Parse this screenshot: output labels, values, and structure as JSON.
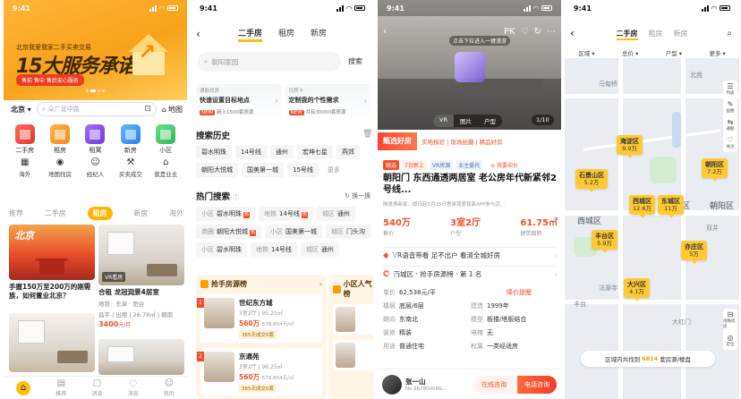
{
  "screen1": {
    "status_time": "9:41",
    "banner": {
      "subtitle": "北京我爱我家二手买卖交易",
      "headline": "15大服务承诺",
      "tag": "售前 售中 售后安心服务"
    },
    "city": "北京",
    "search_placeholder": "朵广营中路",
    "map_label": "地图",
    "main_icons": [
      {
        "label": "二手房"
      },
      {
        "label": "租房"
      },
      {
        "label": "租寓"
      },
      {
        "label": "新房"
      },
      {
        "label": "小区"
      }
    ],
    "sub_icons": [
      {
        "label": "海外",
        "icon": "building-icon"
      },
      {
        "label": "地图找房",
        "icon": "map-pin-icon"
      },
      {
        "label": "经纪人",
        "icon": "agent-icon"
      },
      {
        "label": "买卖成交",
        "icon": "hammer-icon"
      },
      {
        "label": "我是业主",
        "icon": "owner-icon"
      }
    ],
    "tabs": [
      "推荐",
      "二手房",
      "租房",
      "新房",
      "海外"
    ],
    "active_tab": "租房",
    "cards": [
      {
        "title": "手握150万至200万的刚需族，如何置业北京？",
        "image_text": "北京"
      },
      {
        "title": "合租 龙冠润景4居室",
        "meta1": "地铁 · 东单 · 阳台",
        "meta2": "昌平 | 出租 | 26.78㎡ | 朝南",
        "price": "3400",
        "unit": "元/月",
        "vr": "VR看房"
      },
      {
        "title": "",
        "image_text": ""
      },
      {
        "title": "",
        "image_text": ""
      }
    ],
    "nav": [
      "首页",
      "推荐",
      "消息",
      "消息",
      "我的"
    ]
  },
  "screen2": {
    "status_time": "9:41",
    "tabs": [
      "二手房",
      "租房",
      "新房"
    ],
    "active_tab": "二手房",
    "search_placeholder": "朝阳家园",
    "search_btn": "搜索",
    "promos": [
      {
        "top": "通勤找房",
        "title": "快速设置目标地点",
        "badge": "NEW",
        "note": "新上1500套房源"
      },
      {
        "top": "优质卡",
        "title": "定制我的个性需求",
        "badge": "NEW",
        "note": "共有30000套房源"
      }
    ],
    "history_title": "搜索历史",
    "history": [
      "碧水明珠",
      "14号线",
      "通州",
      "宏坤七星",
      "燕郊",
      "朝阳大悦城",
      "国美第一城",
      "15号线",
      "更多"
    ],
    "hot_title": "热门搜索",
    "refresh": "换一换",
    "hot": [
      {
        "k": "小区",
        "v": "碧水明珠",
        "hot": true
      },
      {
        "k": "地铁",
        "v": "14号线",
        "hot": true
      },
      {
        "k": "城区",
        "v": "通州",
        "hot": false
      },
      {
        "k": "商圈",
        "v": "朝阳大悦城",
        "hot": true
      },
      {
        "k": "小区",
        "v": "国美第一城",
        "hot": false
      },
      {
        "k": "城区",
        "v": "门头沟",
        "hot": false
      },
      {
        "k": "小区",
        "v": "碧水明珠",
        "hot": false
      },
      {
        "k": "地铁",
        "v": "14号线",
        "hot": false
      },
      {
        "k": "城区",
        "v": "通州",
        "hot": false
      }
    ],
    "board1_title": "抢手房源榜",
    "board2_title": "小区人气榜",
    "board_items": [
      {
        "rank": "1",
        "name": "世纪东方城",
        "detail": "3室2厅 | 95.25㎡",
        "price": "560万",
        "unit": "578,654元/㎡",
        "sold": "365天成交0套"
      },
      {
        "rank": "2",
        "name": "京通苑",
        "detail": "3室2厅 | 96.25㎡",
        "price": "560万",
        "unit": "578,654元/㎡",
        "sold": "365天成交0套"
      }
    ],
    "board2_items": [
      {
        "sold": "小区人气"
      }
    ]
  },
  "screen3": {
    "status_time": "9:41",
    "hero_badge": "点击下拉进入一键漫游",
    "segments": [
      "VR",
      "图片",
      "户型"
    ],
    "count": "1/10",
    "brand": "甄选好房",
    "strip": "实地核验 | 现场拍摄 | 精品好房",
    "tags": [
      "随选",
      "7日新上",
      "VR房源",
      "业主委托"
    ],
    "bargain": "我要砍价",
    "title": "朝阳门 东西通透两居室 老公房年代新紧邻2号线...",
    "note": "随意换新家，即日起5月15日登录我爱我家APP参与活...",
    "stats": [
      {
        "v": "540万",
        "l": "售价"
      },
      {
        "v": "3室2厅",
        "l": "户型"
      },
      {
        "v": "61.75㎡",
        "l": "建筑面积"
      }
    ],
    "vr_row": "VR语音带看  足不出户 看清全城好房",
    "rank_row": "西城区 · 抢手房源榜 · 第 1 名",
    "details": [
      {
        "k": "单价",
        "v": "62,538元/平",
        "link": "降价提醒"
      },
      {
        "k": "楼层",
        "v": "底层/6层",
        "k2": "建造",
        "v2": "1999年"
      },
      {
        "k": "朝向",
        "v": "东南北",
        "k2": "楼型",
        "v2": "板楼/塔板结合"
      },
      {
        "k": "装修",
        "v": "精装",
        "k2": "电梯",
        "v2": "无"
      },
      {
        "k": "用途",
        "v": "普通住宅",
        "k2": "权属",
        "v2": "一类经适房"
      }
    ],
    "agent_name": "张一山",
    "agent_id": "No.36780008&...",
    "btn_online": "在线咨询",
    "btn_call": "电话咨询"
  },
  "screen4": {
    "status_time": "9:41",
    "tabs": [
      "二手房",
      "租房",
      "新房"
    ],
    "active_tab": "二手房",
    "filters": [
      "区域",
      "总价",
      "户型",
      "更多"
    ],
    "bubbles": [
      {
        "name": "海淀区",
        "count": "9.9万"
      },
      {
        "name": "石景山区",
        "count": "5.2万"
      },
      {
        "name": "西城区",
        "count": "12.6万"
      },
      {
        "name": "东城区",
        "count": "11万"
      },
      {
        "name": "朝阳区",
        "count": "7.2万"
      },
      {
        "name": "丰台区",
        "count": "5.9万"
      },
      {
        "name": "亦庄区",
        "count": "5万"
      },
      {
        "name": "大兴区",
        "count": "4.1万"
      }
    ],
    "labels": [
      "马甸桥",
      "北苑",
      "东城区",
      "西城区",
      "朝阳区",
      "双井",
      "法源寺",
      "丰台",
      "大红门",
      "旧宫"
    ],
    "side_tools": [
      "列表",
      "画圈",
      "通勤",
      "关注"
    ],
    "side_tools2": [
      "地铁找房",
      "定位"
    ],
    "found_prefix": "区域内共找到",
    "found_count": "6814",
    "found_suffix": "套房源/楼盘"
  },
  "colors": {
    "brand_orange": "#ffb400",
    "accent_red": "#f0502a",
    "map_bg": "#e9edf2"
  }
}
